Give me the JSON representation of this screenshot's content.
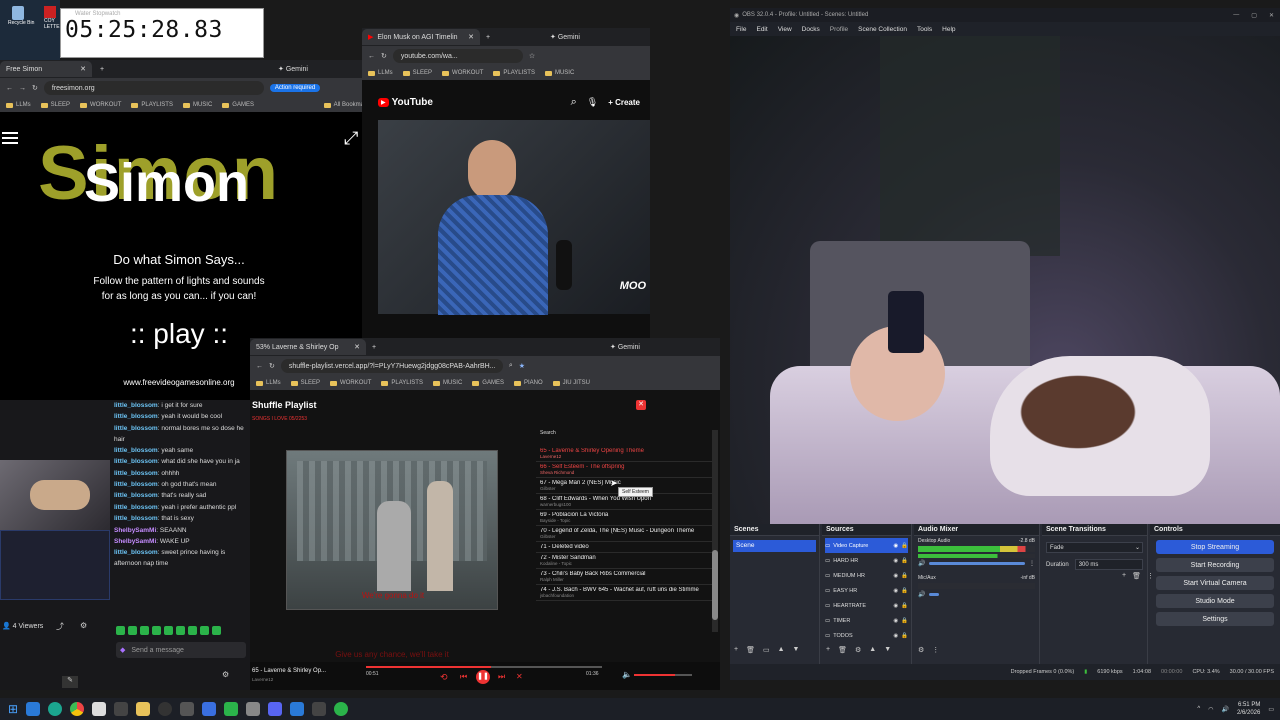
{
  "desktop": {
    "icons": [
      {
        "label": "Recycle Bin"
      },
      {
        "label": "COY"
      },
      {
        "label": "LETTE"
      }
    ]
  },
  "stopwatch": {
    "title": "Water Stopwatch",
    "time": "05:25:28.83"
  },
  "simon_browser": {
    "tab_title": "Free Simon",
    "gemini": "Gemini",
    "url": "freesimon.org",
    "action_required": "Action required",
    "bookmarks": [
      "LLMs",
      "SLEEP",
      "WORKOUT",
      "PLAYLISTS",
      "MUSIC",
      "GAMES"
    ],
    "all_bookmarks": "All Bookmarks",
    "logo_back": "Simon",
    "logo_front": "Simon",
    "tagline": "Do what Simon Says...",
    "desc1": "Follow the pattern of lights and sounds",
    "desc2": "for as long as you can... if you can!",
    "play": ":: play ::",
    "site": "www.freevideogamesonline.org"
  },
  "youtube_browser": {
    "tab_title": "Elon Musk on AGI Timelin",
    "gemini": "Gemini",
    "url": "youtube.com/wa...",
    "bookmarks": [
      "LLMs",
      "SLEEP",
      "WORKOUT",
      "PLAYLISTS",
      "MUSIC"
    ],
    "brand": "YouTube",
    "create": "Create",
    "watermark": "MOO"
  },
  "playlist_browser": {
    "tab_title": "53% Laverne & Shirley Op",
    "gemini": "Gemini",
    "url": "shuffle-playlist.vercel.app/?l=PLyY7Huewg2jdgg08cPAB-AahrBH...",
    "bookmarks": [
      "LLMs",
      "SLEEP",
      "WORKOUT",
      "PLAYLISTS",
      "MUSIC",
      "GAMES",
      "PIANO",
      "JIU JITSU"
    ],
    "page_title": "Shuffle Playlist",
    "playlist_name": "SONGS I LOVE",
    "playlist_date": "05/2253",
    "search": "Search",
    "caption1": "We're gonna do it",
    "caption2": "Give us any chance, we'll take it",
    "tooltip": "Self Esteem",
    "items": [
      {
        "title": "65 - Laverne & Shirley Opening Theme",
        "sub": "Laverne12",
        "active": true
      },
      {
        "title": "66 - Self Esteem - The offspring",
        "sub": "Sheva Richmond",
        "active": true
      },
      {
        "title": "67 - Mega Man 2 (NES) Music",
        "sub": "Gilbster",
        "active": false
      },
      {
        "title": "68 - Cliff Edwards - When You Wish Upon",
        "sub": "warnerbugs100",
        "active": false
      },
      {
        "title": "69 - Población La Victoria",
        "sub": "Bayside - Topic",
        "active": false
      },
      {
        "title": "70 - Legend of Zelda, The (NES) Music - Dungeon Theme",
        "sub": "Gilbster",
        "active": false
      },
      {
        "title": "71 - Deleted video",
        "sub": "",
        "active": false
      },
      {
        "title": "72 - Mister Sandman",
        "sub": "Kodaline - Topic",
        "active": false
      },
      {
        "title": "73 - Chili's Baby Back Ribs Commercial",
        "sub": "Ralph Miller",
        "active": false
      },
      {
        "title": "74 - J.S. Bach - BWV 645 - Wachet auf, ruft uns die Stimme",
        "sub": "jsbachfoundation",
        "active": false
      }
    ],
    "now_playing": "65 - Laverne & Shirley Op...",
    "now_playing_sub": "Laverne12",
    "time_current": "00:51",
    "time_total": "01:36",
    "progress_fraction": 0.53,
    "volume_fraction": 0.7
  },
  "chat": {
    "lines": [
      {
        "user": "little_blossom",
        "msg": "i get it for sure",
        "purple": false
      },
      {
        "user": "little_blossom",
        "msg": "yeah it would be cool",
        "purple": false
      },
      {
        "user": "little_blossom",
        "msg": "normal bores me so dose he hair",
        "purple": false
      },
      {
        "user": "little_blossom",
        "msg": "",
        "purple": false
      },
      {
        "user": "little_blossom",
        "msg": "yeah same",
        "purple": false
      },
      {
        "user": "little_blossom",
        "msg": "what did she have you in ja",
        "purple": false
      },
      {
        "user": "little_blossom",
        "msg": "ohhhh",
        "purple": false
      },
      {
        "user": "little_blossom",
        "msg": "oh god that's mean",
        "purple": false
      },
      {
        "user": "little_blossom",
        "msg": "that's really sad",
        "purple": false
      },
      {
        "user": "little_blossom",
        "msg": "yeah i prefer authentic ppl",
        "purple": false
      },
      {
        "user": "little_blossom",
        "msg": "that is sexy",
        "purple": false
      },
      {
        "user": "ShelbySamMi",
        "msg": "SEAANN",
        "purple": true
      },
      {
        "user": "ShelbySamMi",
        "msg": "WAKE UP",
        "purple": true
      },
      {
        "user": "little_blossom",
        "msg": "sweet prince having is afternoon nap time",
        "purple": false
      }
    ],
    "viewers_label": "4 Viewers",
    "send_placeholder": "Send a message"
  },
  "obs": {
    "title": "OBS 32.0.4 - Profile: Untitled - Scenes: Untitled",
    "menu": [
      "File",
      "Edit",
      "View",
      "Docks",
      "Profile",
      "Scene Collection",
      "Tools",
      "Help"
    ],
    "scenes_title": "Scenes",
    "scenes": [
      "Scene"
    ],
    "sources_title": "Sources",
    "sources": [
      "Video Capture",
      "HARD HR",
      "MEDIUM HR",
      "EASY HR",
      "HEARTRATE",
      "TIMER",
      "TODOS"
    ],
    "mixer_title": "Audio Mixer",
    "mixer": [
      {
        "name": "Desktop Audio",
        "db": "-2.8 dB"
      },
      {
        "name": "Mic/Aux",
        "db": "-inf dB"
      }
    ],
    "transitions_title": "Scene Transitions",
    "transition": "Fade",
    "duration_label": "Duration",
    "duration": "300 ms",
    "controls_title": "Controls",
    "controls": [
      "Stop Streaming",
      "Start Recording",
      "Start Virtual Camera",
      "Studio Mode",
      "Settings"
    ],
    "status": {
      "dropped": "Dropped Frames 0 (0.0%)",
      "bitrate": "6190 kbps",
      "live": "1:04:08",
      "rec": "00:00:00",
      "cpu": "CPU: 3.4%",
      "fps": "30.00 / 30.00 FPS"
    }
  },
  "taskbar": {
    "time": "6:51 PM",
    "date": "2/6/2026"
  },
  "colors": {
    "obs_bg": "#272a33",
    "obs_accent": "#2c5bd8",
    "simon_gold": "#9ea02a",
    "playlist_red": "#e33"
  }
}
